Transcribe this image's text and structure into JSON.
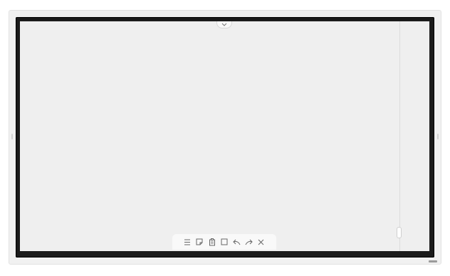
{
  "device": {
    "frame_color": "#f1f1f1",
    "bezel_color": "#1b1b1b",
    "canvas_color": "#efefef"
  },
  "top_handle": {
    "icon": "chevron-down-icon"
  },
  "toolbar": {
    "items": [
      {
        "name": "menu",
        "icon": "menu-icon"
      },
      {
        "name": "note",
        "icon": "note-icon"
      },
      {
        "name": "page",
        "icon": "page-icon"
      },
      {
        "name": "select",
        "icon": "select-rectangle-icon"
      },
      {
        "name": "undo",
        "icon": "undo-icon"
      },
      {
        "name": "redo",
        "icon": "redo-icon"
      },
      {
        "name": "close",
        "icon": "close-icon"
      }
    ]
  }
}
